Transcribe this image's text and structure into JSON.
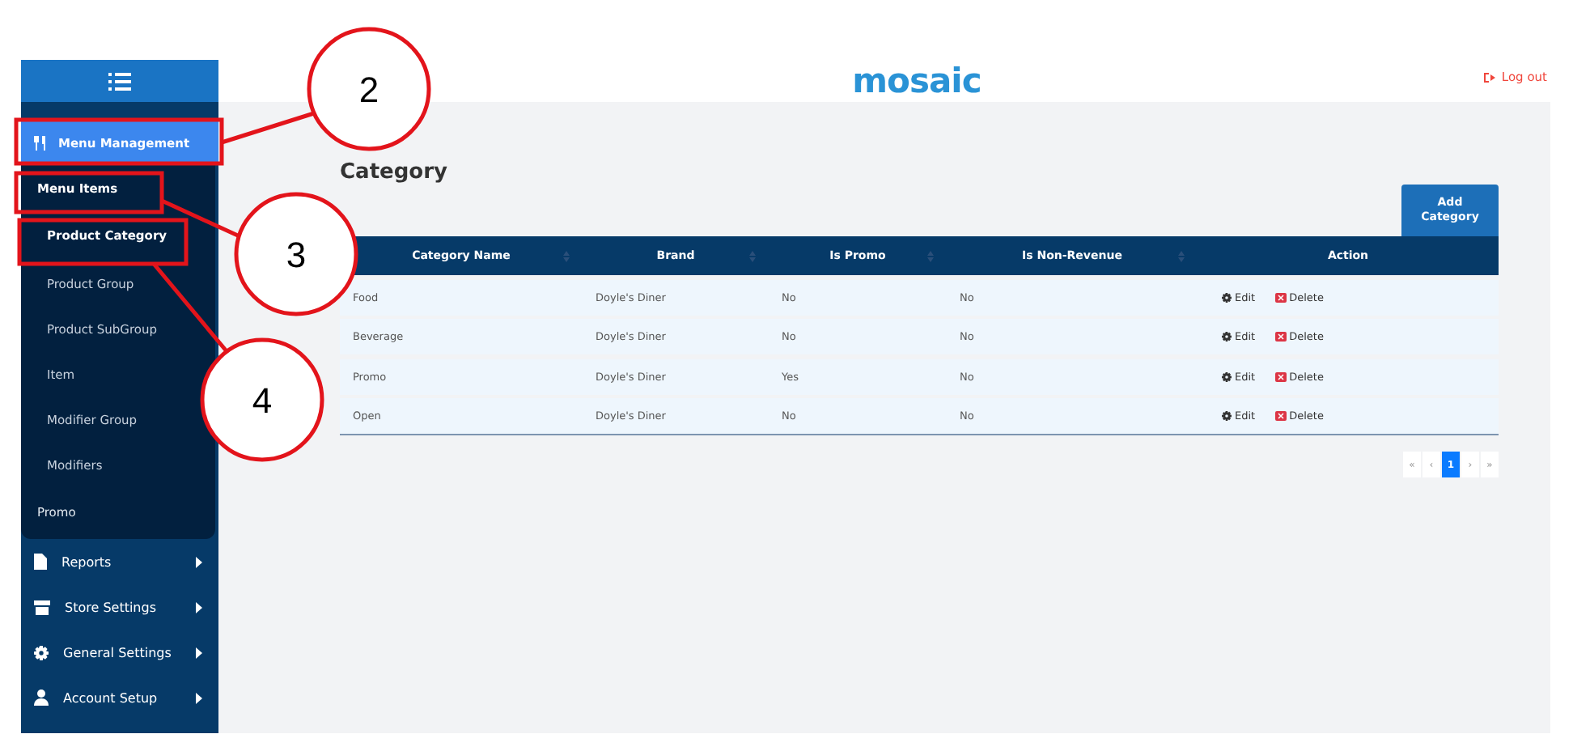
{
  "header": {
    "logo": "mosaic",
    "logout": "Log out"
  },
  "sidebar": {
    "active": {
      "label": "Menu Management",
      "selected": true
    },
    "submenu": {
      "title": "Menu Items",
      "items": [
        {
          "label": "Product Category",
          "selected": true
        },
        {
          "label": "Product Group",
          "selected": false
        },
        {
          "label": "Product SubGroup",
          "selected": false
        },
        {
          "label": "Item",
          "selected": false
        },
        {
          "label": "Modifier Group",
          "selected": false
        },
        {
          "label": "Modifiers",
          "selected": false
        }
      ],
      "extra": "Promo"
    },
    "items": [
      {
        "label": "Reports",
        "kind": "report"
      },
      {
        "label": "Store Settings",
        "kind": "store"
      },
      {
        "label": "General Settings",
        "kind": "gear"
      },
      {
        "label": "Account Setup",
        "kind": "user"
      }
    ]
  },
  "page": {
    "title": "Category",
    "add_button": "Add Category"
  },
  "table": {
    "columns": [
      {
        "label": "Category Name",
        "sortable": true
      },
      {
        "label": "Brand",
        "sortable": true
      },
      {
        "label": "Is Promo",
        "sortable": true
      },
      {
        "label": "Is Non-Revenue",
        "sortable": true
      },
      {
        "label": "Action",
        "sortable": false
      }
    ],
    "rows": [
      {
        "cells": [
          "Food",
          "Doyle's Diner",
          "No",
          "No"
        ],
        "edit": "Edit",
        "delete": "Delete"
      },
      {
        "cells": [
          "Beverage",
          "Doyle's Diner",
          "No",
          "No"
        ],
        "edit": "Edit",
        "delete": "Delete"
      },
      {
        "cells": [
          "Promo",
          "Doyle's Diner",
          "Yes",
          "No"
        ],
        "edit": "Edit",
        "delete": "Delete"
      },
      {
        "cells": [
          "Open",
          "Doyle's Diner",
          "No",
          "No"
        ],
        "edit": "Edit",
        "delete": "Delete"
      }
    ]
  },
  "pagination": [
    {
      "label": "«",
      "selected": false
    },
    {
      "label": "‹",
      "selected": false
    },
    {
      "label": "1",
      "selected": true
    },
    {
      "label": "›",
      "selected": false
    },
    {
      "label": "»",
      "selected": false
    }
  ],
  "callouts": [
    {
      "label": "2"
    },
    {
      "label": "3"
    },
    {
      "label": "4"
    }
  ]
}
